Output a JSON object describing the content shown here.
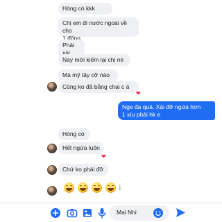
{
  "messages": {
    "m1": "Hòng có kkk",
    "m2": "Chị em đi nước ngoài về cho\n1 đống",
    "m3": "Phải xài",
    "m4": "Nay mới kiếm lại chị nè",
    "m5": "Mà mỹ tây cỡ nào",
    "m6": "Cũng ko đã bằng chai c á",
    "m7": "Nge đa quá. Xài đỡ ngứa hơn\n1 xíu phải hk e",
    "m8": "Hòng có",
    "m9": "Hết ngứa luôn",
    "m10": "Chứ ko phải đỡ"
  },
  "reaction": {
    "icon": "heart-icon",
    "glyph": "❤",
    "color": "#e8284a"
  },
  "composer": {
    "placeholder": "Mai Nhi",
    "icons": [
      "plus-circle-icon",
      "camera-icon",
      "image-icon",
      "microphone-icon",
      "emoji-icon",
      "send-icon"
    ]
  },
  "colors": {
    "accent": "#1f6df2",
    "incoming_bubble": "#eef0f3"
  }
}
